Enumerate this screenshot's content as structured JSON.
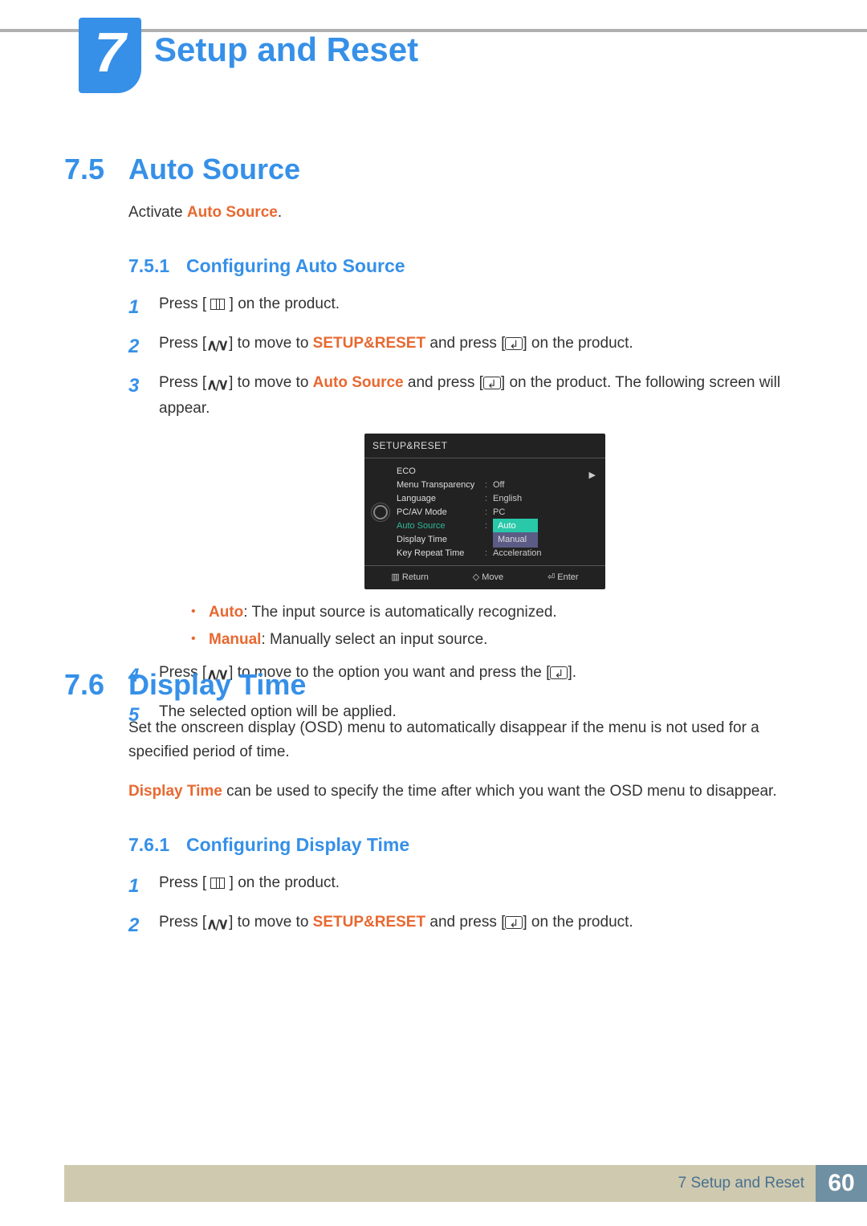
{
  "chapter": {
    "number": "7",
    "title": "Setup and Reset"
  },
  "sections": {
    "s75": {
      "num": "7.5",
      "title": "Auto Source",
      "intro_prefix": "Activate ",
      "intro_term": "Auto Source",
      "intro_suffix": ".",
      "sub": {
        "num": "7.5.1",
        "title": "Configuring Auto Source"
      },
      "step1_a": "Press [ ",
      "step1_b": " ] on the product.",
      "step2_a": "Press [",
      "step2_b": "] to move to ",
      "step2_term": "SETUP&RESET",
      "step2_c": " and press [",
      "step2_d": "] on the product.",
      "step3_a": "Press [",
      "step3_b": "] to move to ",
      "step3_term": "Auto Source",
      "step3_c": " and press [",
      "step3_d": "] on the product. The following screen will appear.",
      "bullet_auto_term": "Auto",
      "bullet_auto_text": ": The input source is automatically recognized.",
      "bullet_manual_term": "Manual",
      "bullet_manual_text": ": Manually select an input source.",
      "step4_a": "Press [",
      "step4_b": "] to move to the option you want and press the [",
      "step4_c": "].",
      "step5": "The selected option will be applied.",
      "step_numbers": {
        "n1": "1",
        "n2": "2",
        "n3": "3",
        "n4": "4",
        "n5": "5"
      }
    },
    "s76": {
      "num": "7.6",
      "title": "Display Time",
      "para1": "Set the onscreen display (OSD) menu to automatically disappear if the menu is not used for a specified period of time.",
      "para2_term": "Display Time",
      "para2_text": " can be used to specify the time after which you want the OSD menu to disappear.",
      "sub": {
        "num": "7.6.1",
        "title": "Configuring Display Time"
      },
      "step1_a": "Press [ ",
      "step1_b": " ] on the product.",
      "step2_a": "Press [",
      "step2_b": "] to move to ",
      "step2_term": "SETUP&RESET",
      "step2_c": " and press [",
      "step2_d": "] on the product.",
      "step_numbers": {
        "n1": "1",
        "n2": "2"
      }
    }
  },
  "osd": {
    "title": "SETUP&RESET",
    "rows": [
      {
        "label": "ECO",
        "value": ""
      },
      {
        "label": "Menu Transparency",
        "value": "Off"
      },
      {
        "label": "Language",
        "value": "English"
      },
      {
        "label": "PC/AV Mode",
        "value": "PC"
      },
      {
        "label": "Auto Source",
        "value": "",
        "highlight": true
      },
      {
        "label": "Display Time",
        "value": ""
      },
      {
        "label": "Key Repeat Time",
        "value": "Acceleration"
      }
    ],
    "dropdown": {
      "auto": "Auto",
      "manual": "Manual"
    },
    "arrow": "▶",
    "foot": {
      "return": "Return",
      "move": "Move",
      "enter": "Enter"
    },
    "foot_icons": {
      "return": "▥",
      "move": "◇",
      "enter": "⏎"
    }
  },
  "footer": {
    "label": "7 Setup and Reset",
    "page": "60"
  }
}
